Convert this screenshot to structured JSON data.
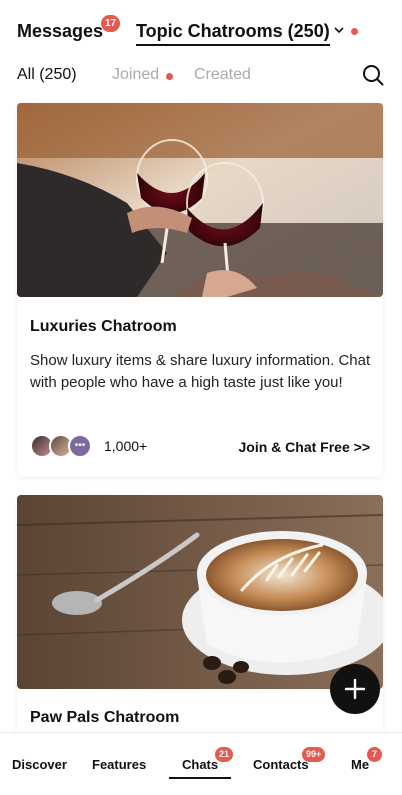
{
  "header": {
    "messages_label": "Messages",
    "messages_badge": "17",
    "topic_label": "Topic Chatrooms (250)"
  },
  "filters": {
    "all": "All (250)",
    "joined": "Joined",
    "created": "Created"
  },
  "cards": [
    {
      "title": "Luxuries Chatroom",
      "description": "Show luxury items & share luxury information. Chat with people who have a high taste just like you!",
      "member_count": "1,000+",
      "join_label": "Join & Chat Free >>",
      "image": "wine-toast-photo"
    },
    {
      "title": "Paw Pals Chatroom",
      "image": "latte-coffee-photo"
    }
  ],
  "fab": {
    "icon": "plus-icon"
  },
  "bottom_nav": {
    "discover": "Discover",
    "features": "Features",
    "chats": "Chats",
    "chats_badge": "21",
    "contacts": "Contacts",
    "contacts_badge": "99+",
    "me": "Me",
    "me_badge": "7"
  },
  "colors": {
    "badge_red": "#e55a4f",
    "text": "#111111",
    "muted": "#aaaaaa"
  }
}
